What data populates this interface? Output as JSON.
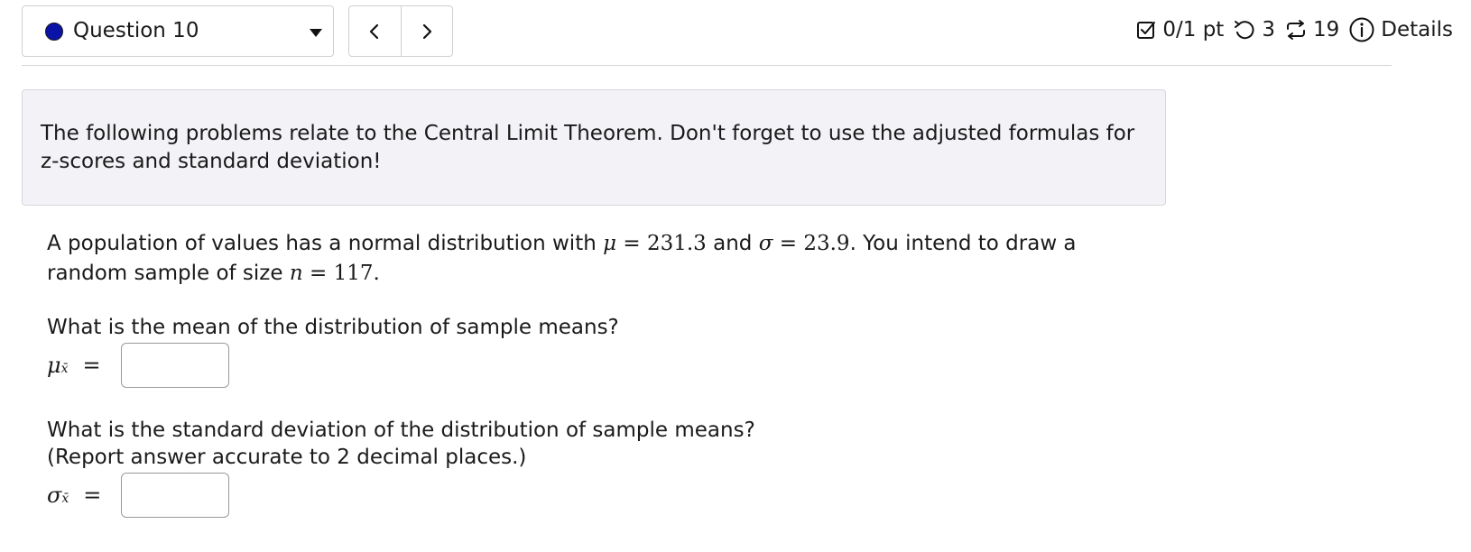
{
  "header": {
    "question_label": "Question 10",
    "score": "0/1 pt",
    "attempts": "3",
    "retries": "19",
    "details_label": "Details"
  },
  "colors": {
    "question_dot": "#0a13a8",
    "intro_background": "#f2f2f7"
  },
  "icons": {
    "question_dot": "filled-circle",
    "dropdown": "caret-down-icon",
    "prev": "chevron-left-icon",
    "next": "chevron-right-icon",
    "score": "checkbox-icon",
    "attempts": "undo-icon",
    "retries": "repeat-icon",
    "details": "info-icon"
  },
  "intro": {
    "text": "The following problems relate to the Central Limit Theorem. Don't forget to use the adjusted formulas for z-scores and standard deviation!"
  },
  "problem": {
    "text_1": "A population of values has a normal distribution with ",
    "mu_symbol": "μ",
    "mu_value": "231.3",
    "text_2": " and ",
    "sigma_symbol": "σ",
    "sigma_value": "23.9",
    "text_3": ". You intend to draw a random sample of size ",
    "n_symbol": "n",
    "n_value": "117",
    "text_4": "."
  },
  "question_1": {
    "prompt": "What is the mean of the distribution of sample means?",
    "label_symbol": "μ",
    "label_sub": "x̄",
    "answer_value": ""
  },
  "question_2": {
    "prompt": "What is the standard deviation of the distribution of sample means?",
    "note": "(Report answer accurate to 2 decimal places.)",
    "label_symbol": "σ",
    "label_sub": "x̄",
    "answer_value": ""
  }
}
